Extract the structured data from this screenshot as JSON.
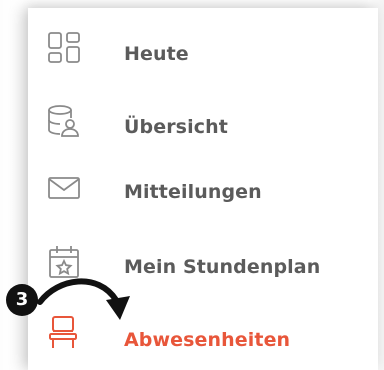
{
  "menu": {
    "items": [
      {
        "label": "Heute",
        "icon": "dashboard-grid-icon",
        "active": false
      },
      {
        "label": "Übersicht",
        "icon": "database-user-icon",
        "active": false
      },
      {
        "label": "Mitteilungen",
        "icon": "envelope-icon",
        "active": false
      },
      {
        "label": "Mein Stundenplan",
        "icon": "calendar-star-icon",
        "active": false
      },
      {
        "label": "Abwesenheiten",
        "icon": "chair-icon",
        "active": true
      }
    ]
  },
  "annotation": {
    "step_number": "3"
  },
  "colors": {
    "icon_gray": "#8a8a8a",
    "label_gray": "#5b5b5b",
    "accent": "#e8563a",
    "badge": "#111111"
  }
}
